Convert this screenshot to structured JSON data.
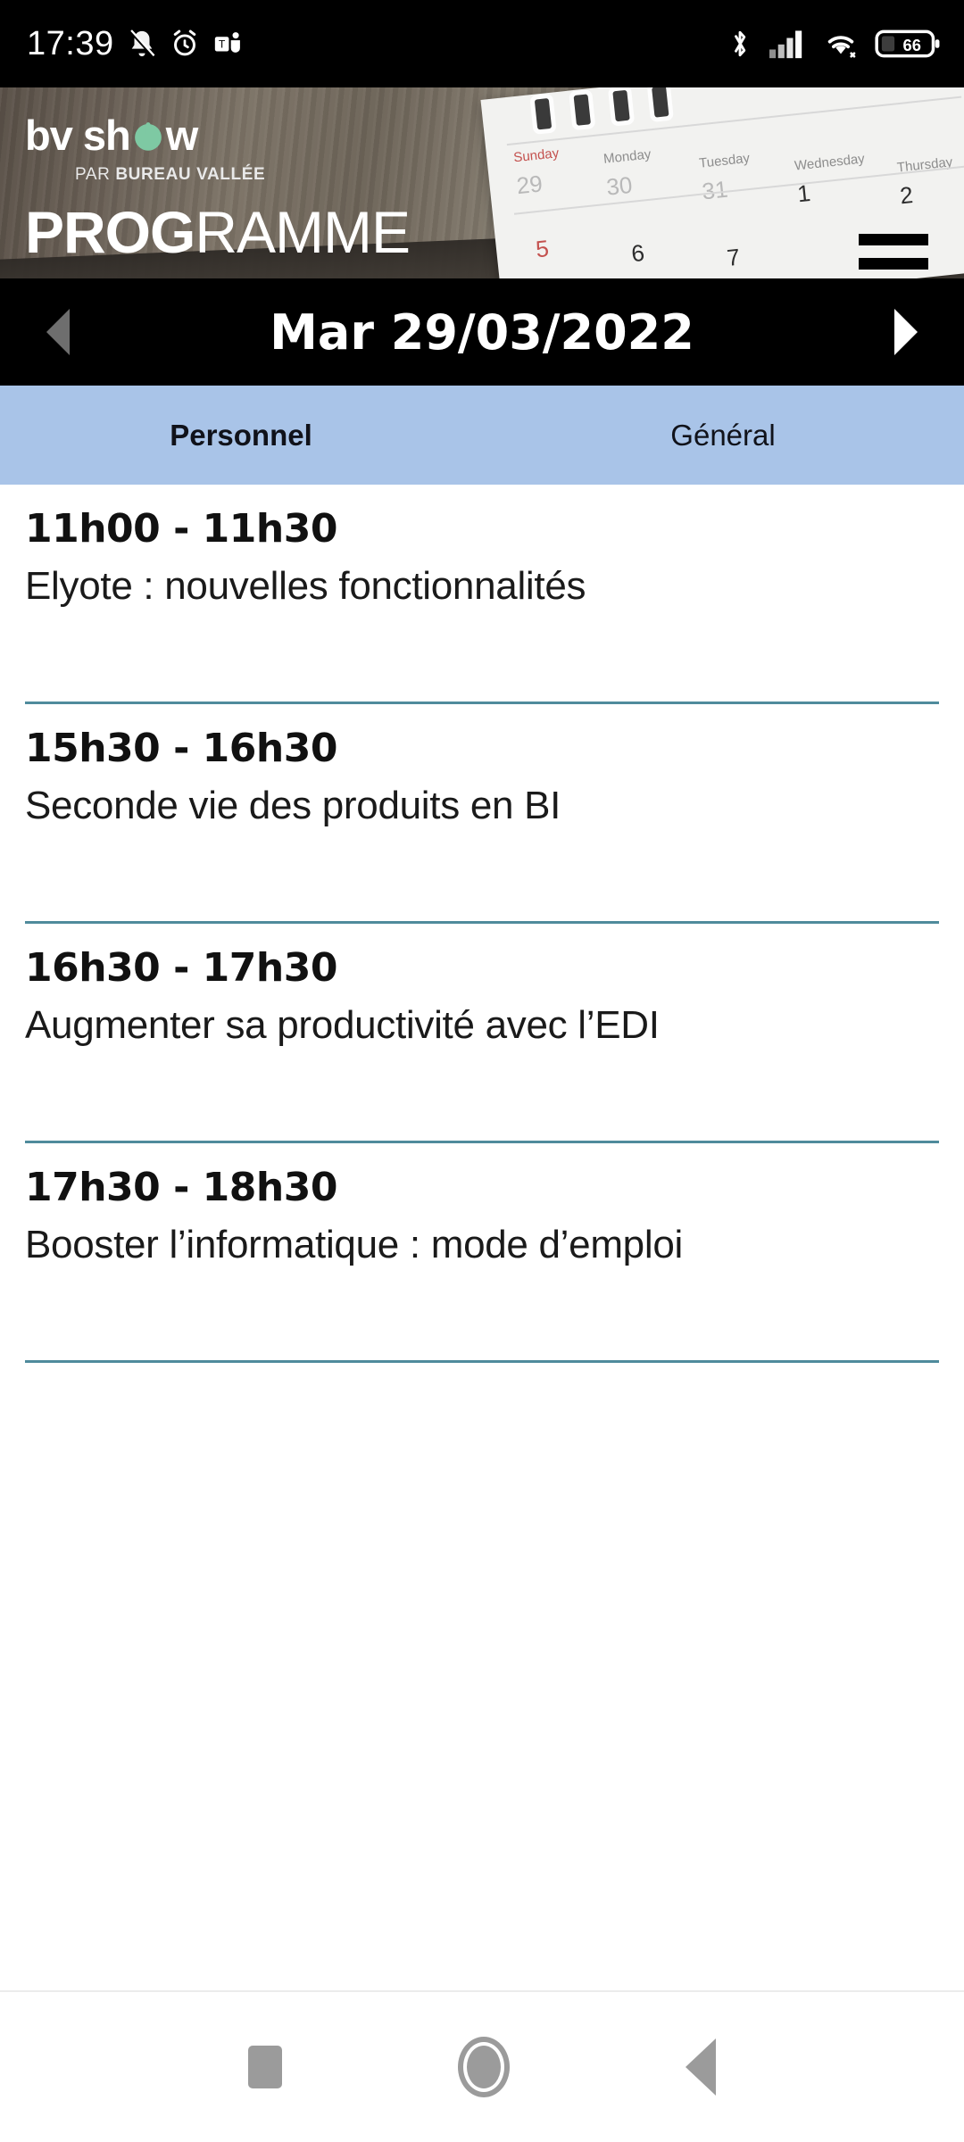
{
  "status_bar": {
    "time": "17:39",
    "left_icons": [
      "bell-off-icon",
      "alarm-clock-icon",
      "microsoft-teams-icon"
    ],
    "right_icons": [
      "bluetooth-icon",
      "cellular-signal-icon",
      "wifi-icon",
      "battery-icon"
    ],
    "battery_level": "66"
  },
  "hero": {
    "brand_name_part1": "bv sh",
    "brand_name_part2": "w",
    "brand_subtitle_prefix": "PAR ",
    "brand_subtitle_strong": "BUREAU VALLÉE",
    "page_title_bold": "PROG",
    "page_title_light": "RAMME",
    "menu_icon": "hamburger-menu-icon",
    "calendar_days": [
      "Sunday",
      "Monday",
      "Tuesday",
      "Wednesday",
      "Thursday"
    ],
    "calendar_row1": [
      "29",
      "30",
      "31",
      "1",
      "2"
    ],
    "calendar_row2": [
      "5",
      "6",
      "7",
      "",
      ""
    ]
  },
  "date_nav": {
    "prev_label": "previous-day-arrow",
    "next_label": "next-day-arrow",
    "current_date": "Mar 29/03/2022"
  },
  "tabs": [
    {
      "label": "Personnel",
      "active": true
    },
    {
      "label": "Général",
      "active": false
    }
  ],
  "schedule": [
    {
      "time": "11h00 - 11h30",
      "title": "Elyote : nouvelles fonctionnalités"
    },
    {
      "time": "15h30 - 16h30",
      "title": "Seconde vie des produits en BI"
    },
    {
      "time": "16h30 - 17h30",
      "title": "Augmenter sa productivité avec l’EDI"
    },
    {
      "time": "17h30 - 18h30",
      "title": "Booster l’informatique : mode d’emploi"
    }
  ],
  "navigation_bar": {
    "recents_icon": "square-recents-icon",
    "home_icon": "circle-home-icon",
    "back_icon": "triangle-back-icon"
  },
  "colors": {
    "tab_bar_bg": "#a9c4e8",
    "separator": "#4f8b9c",
    "brand_green": "#7ec9a3",
    "status_bar_bg": "#000000",
    "date_bar_bg": "#000000"
  }
}
